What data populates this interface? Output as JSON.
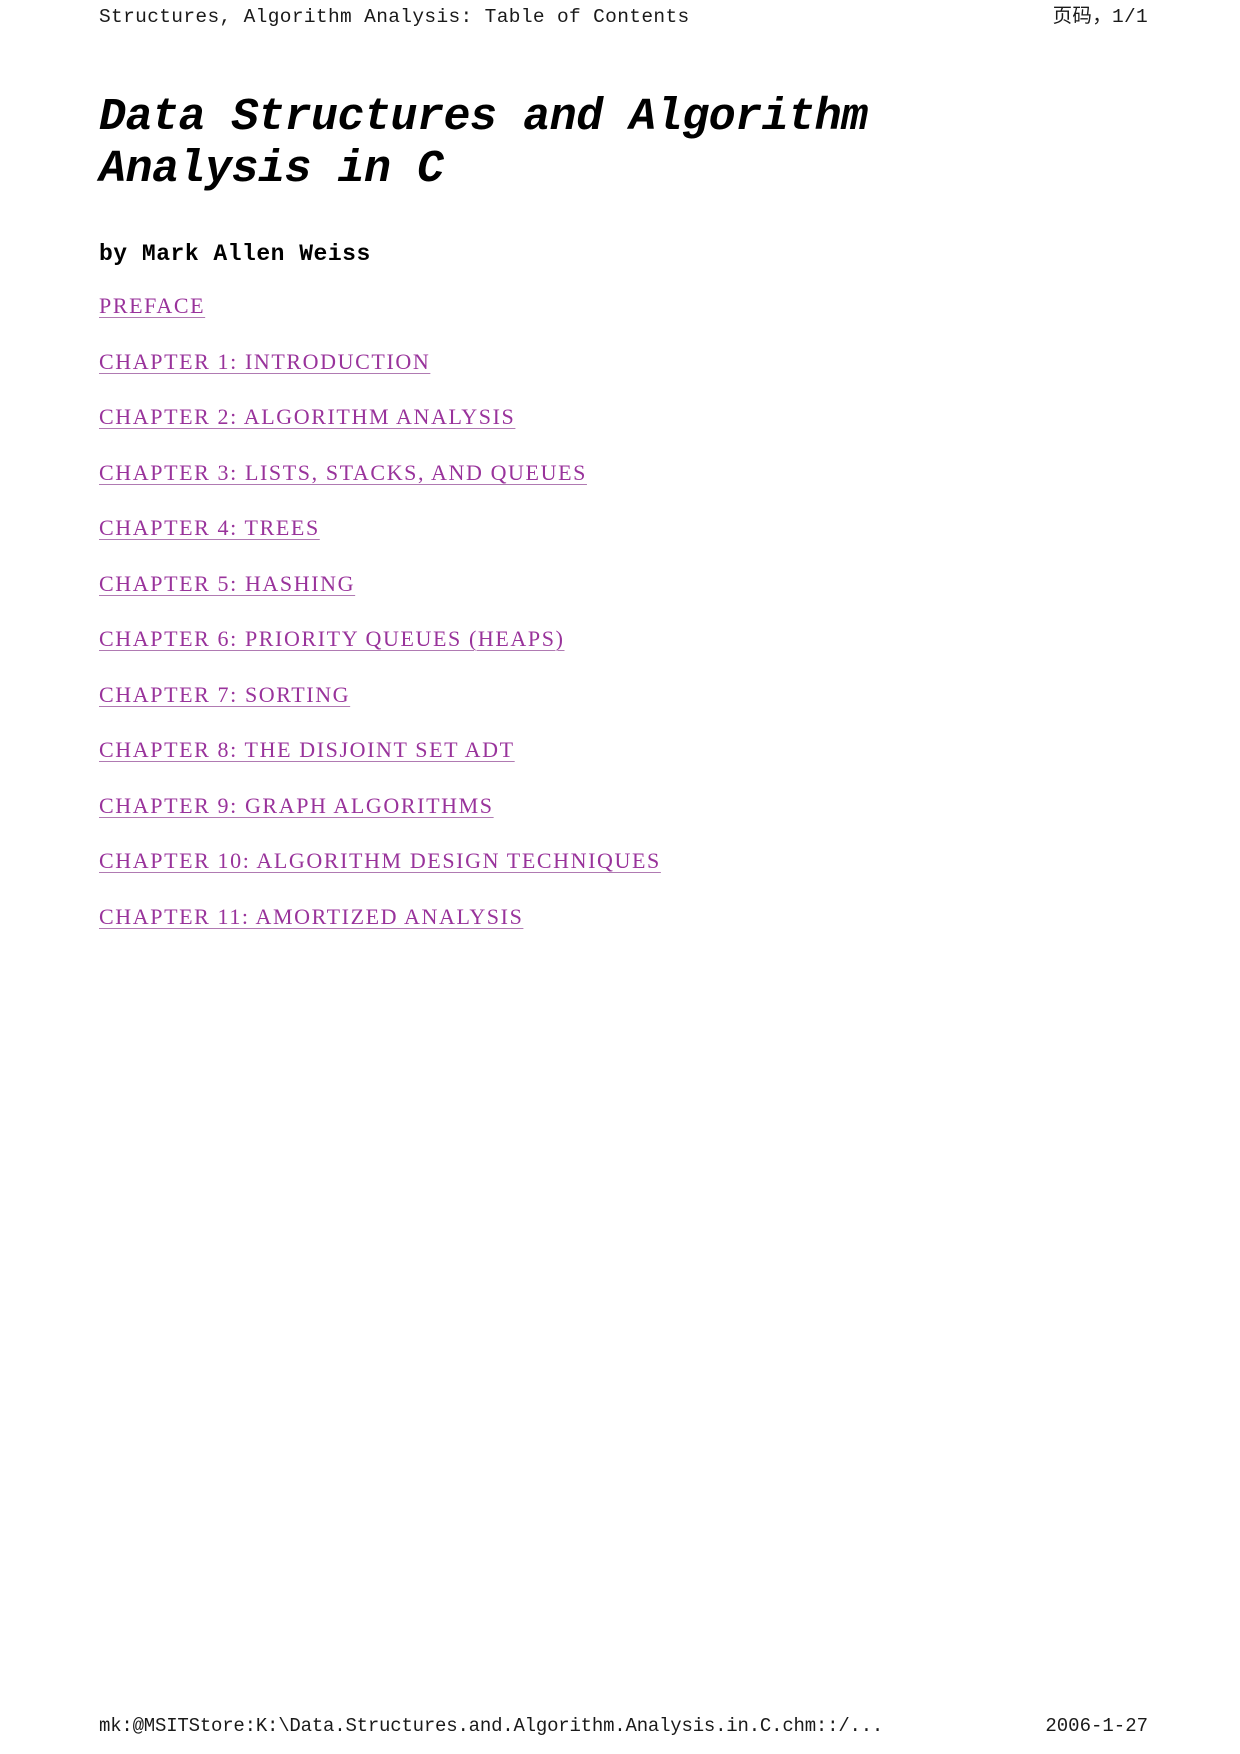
{
  "header": {
    "title": "Structures, Algorithm Analysis: Table of Contents",
    "page_number": "页码，1/1"
  },
  "document": {
    "title": "Data Structures and Algorithm Analysis in C",
    "author_line": "by Mark Allen Weiss"
  },
  "toc": {
    "items": [
      {
        "label": "PREFACE"
      },
      {
        "label": "CHAPTER 1: INTRODUCTION"
      },
      {
        "label": "CHAPTER 2: ALGORITHM ANALYSIS"
      },
      {
        "label": "CHAPTER 3: LISTS, STACKS, AND QUEUES"
      },
      {
        "label": "CHAPTER 4: TREES"
      },
      {
        "label": "CHAPTER 5: HASHING"
      },
      {
        "label": "CHAPTER 6: PRIORITY QUEUES (HEAPS)"
      },
      {
        "label": "CHAPTER 7: SORTING"
      },
      {
        "label": "CHAPTER 8: THE DISJOINT SET ADT"
      },
      {
        "label": "CHAPTER 9: GRAPH ALGORITHMS"
      },
      {
        "label": "CHAPTER 10: ALGORITHM DESIGN TECHNIQUES"
      },
      {
        "label": "CHAPTER 11: AMORTIZED ANALYSIS"
      }
    ]
  },
  "footer": {
    "source_path": "mk:@MSITStore:K:\\Data.Structures.and.Algorithm.Analysis.in.C.chm::/...",
    "date": "2006-1-27"
  },
  "colors": {
    "link": "#99339b",
    "text": "#000000",
    "chrome_text": "#1a1a1a",
    "background": "#ffffff"
  }
}
